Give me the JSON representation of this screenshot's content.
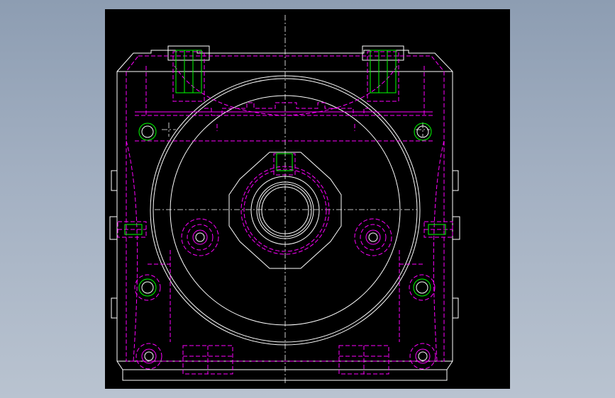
{
  "colors": {
    "background_gradient_top": "#8d9db2",
    "background_gradient_bottom": "#b9c3d0",
    "viewport": "#000000",
    "outline": "#ffffff",
    "hidden": "#ff00ff",
    "feature": "#00ff00"
  },
  "drawing": {
    "view": "front-view",
    "line_styles": [
      "solid",
      "dashed",
      "dash-dot"
    ]
  }
}
